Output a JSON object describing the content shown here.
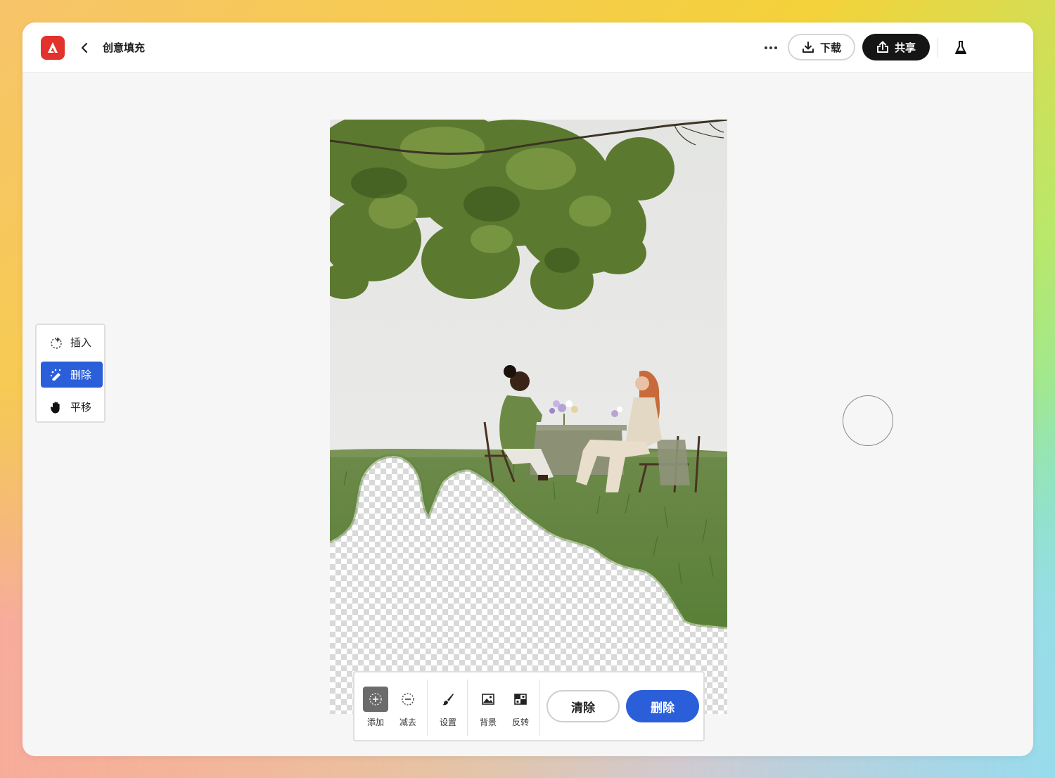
{
  "header": {
    "title": "创意填充",
    "download_label": "下载",
    "share_label": "共享",
    "logo_icon": "adobe-express-logo",
    "back_icon": "chevron-left-icon",
    "more_icon": "more-icon",
    "lab_icon": "beaker-icon"
  },
  "side_tools": {
    "items": [
      {
        "label": "插入",
        "icon": "insert-sparkle-icon",
        "active": false
      },
      {
        "label": "删除",
        "icon": "remove-eraser-icon",
        "active": true
      },
      {
        "label": "平移",
        "icon": "hand-icon",
        "active": false
      }
    ]
  },
  "toolbar": {
    "add_label": "添加",
    "subtract_label": "减去",
    "settings_label": "设置",
    "background_label": "背景",
    "invert_label": "反转",
    "clear_label": "清除",
    "delete_label": "删除"
  },
  "colors": {
    "accent": "#2b5fd9",
    "logo_red": "#e3312b",
    "share_bg": "#151515"
  }
}
